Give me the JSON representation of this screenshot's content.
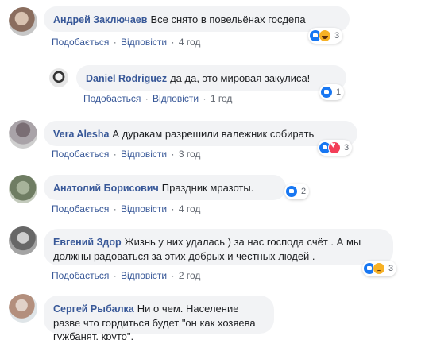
{
  "actions": {
    "like": "Подобається",
    "reply": "Відповісти",
    "separator": "·"
  },
  "comments": [
    {
      "author": "Андрей Заключаев",
      "text": "Все снято в повельёнах госдепа",
      "time": "4 год",
      "reactions": [
        "like",
        "haha"
      ],
      "reaction_count": "3"
    },
    {
      "author": "Daniel Rodriguez",
      "text": "да да, это мировая закулиса!",
      "time": "1 год",
      "reactions": [
        "like"
      ],
      "reaction_count": "1"
    },
    {
      "author": "Vera Alesha",
      "text": "А дуракам разрешили валежник собирать",
      "time": "3 год",
      "reactions": [
        "like",
        "love"
      ],
      "reaction_count": "3"
    },
    {
      "author": "Анатолий Борисович",
      "text": "Праздник мразоты.",
      "time": "4 год",
      "reactions": [
        "like"
      ],
      "reaction_count": "2"
    },
    {
      "author": "Евгений Здор",
      "text": "Жизнь у них удалась ) за нас господа счёт . А мы должны радоваться за этих добрых и честных людей .",
      "time": "2 год",
      "reactions": [
        "like",
        "sad"
      ],
      "reaction_count": "3"
    },
    {
      "author": "Сергей Рыбалка",
      "text": "Ни о чем. Население разве что гордиться будет \"он как хозяева гужбанят, круто\".",
      "time": "",
      "reactions": [],
      "reaction_count": ""
    }
  ],
  "colors": {
    "author": "#385898",
    "bubble": "#f2f3f5",
    "meta": "#616770",
    "like": "#1877f2",
    "love": "#f33e58",
    "emoji": "#f7b125"
  }
}
